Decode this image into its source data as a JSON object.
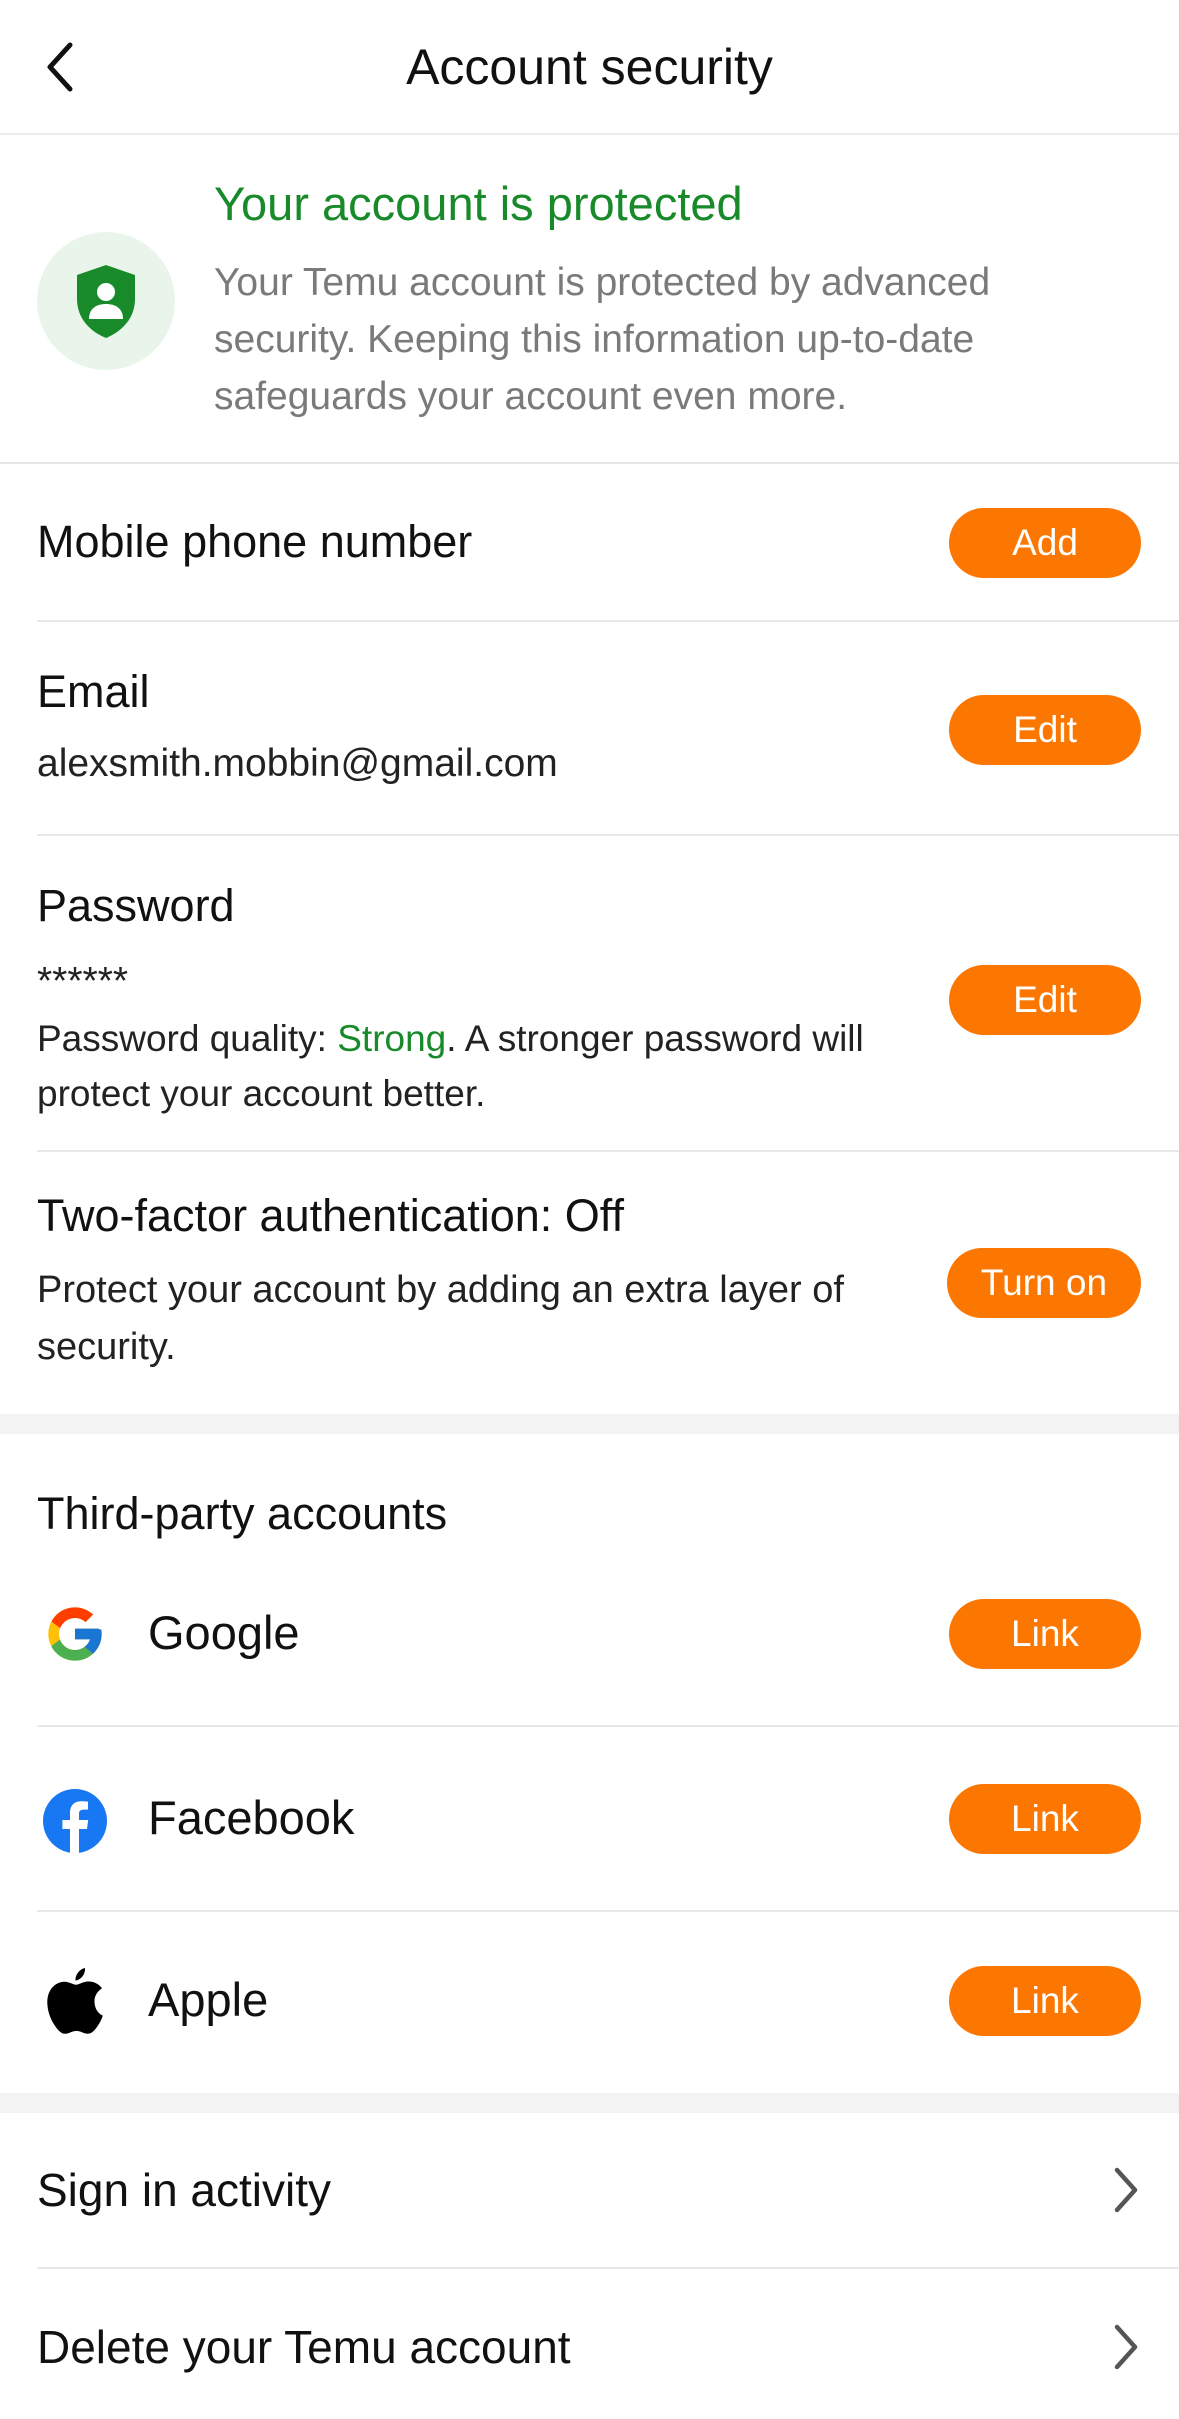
{
  "header": {
    "title": "Account security",
    "back_icon": "chevron-left-icon"
  },
  "banner": {
    "title": "Your account is protected",
    "description": "Your Temu account is protected by advanced security. Keeping this information up-to-date safeguards your account even more.",
    "icon": "shield-user-icon",
    "colors": {
      "title": "#188a2a",
      "shield": "#188a2a",
      "circle": "#e9f5ea"
    }
  },
  "phone": {
    "title": "Mobile phone number",
    "action": "Add"
  },
  "email": {
    "title": "Email",
    "value": "alexsmith.mobbin@gmail.com",
    "action": "Edit"
  },
  "password": {
    "title": "Password",
    "masked": "******",
    "quality_prefix": "Password quality: ",
    "quality_value": "Strong",
    "quality_suffix": ". A stronger password will protect your account better.",
    "action": "Edit"
  },
  "two_factor": {
    "title": "Two-factor authentication: Off",
    "description": "Protect your account by adding an extra layer of security.",
    "action": "Turn on"
  },
  "third_party": {
    "title": "Third-party accounts",
    "items": [
      {
        "name": "Google",
        "icon": "google-icon",
        "action": "Link"
      },
      {
        "name": "Facebook",
        "icon": "facebook-icon",
        "action": "Link"
      },
      {
        "name": "Apple",
        "icon": "apple-icon",
        "action": "Link"
      }
    ]
  },
  "links": [
    {
      "label": "Sign in activity",
      "icon": "chevron-right-icon"
    },
    {
      "label": "Delete your Temu account",
      "icon": "chevron-right-icon"
    }
  ],
  "theme": {
    "accent": "#fb7701",
    "success": "#188a2a"
  }
}
